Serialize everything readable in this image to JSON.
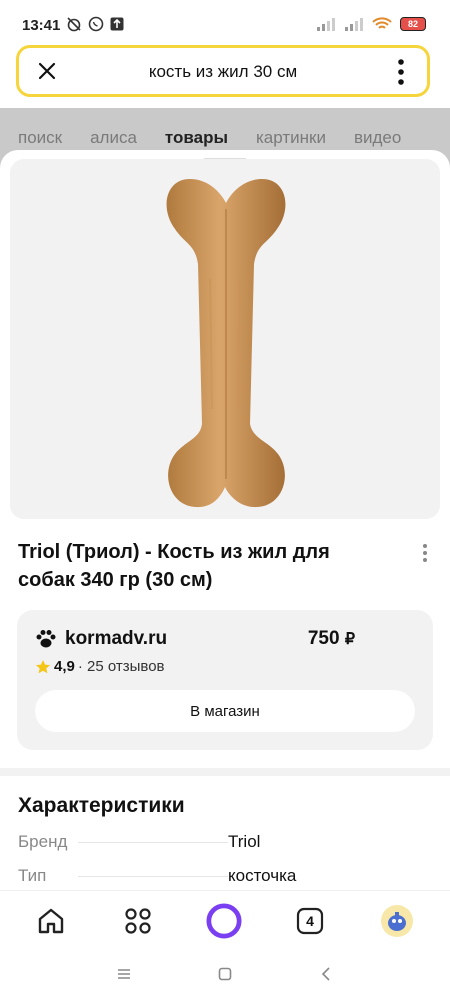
{
  "status": {
    "time": "13:41",
    "battery": "82"
  },
  "search": {
    "query": "кость из жил 30 см"
  },
  "tabs": [
    {
      "label": "поиск"
    },
    {
      "label": "алиса"
    },
    {
      "label": "товары"
    },
    {
      "label": "картинки"
    },
    {
      "label": "видео"
    }
  ],
  "product": {
    "title": "Triol (Триол) - Кость из жил для собак 340 гр (30 см)"
  },
  "shop": {
    "name": "kormadv.ru",
    "price": "750",
    "currency": "₽",
    "rating": "4,9",
    "reviews": "· 25 отзывов",
    "button": "В магазин"
  },
  "characteristics": {
    "title": "Характеристики",
    "rows": [
      {
        "key": "Бренд",
        "value": "Triol"
      },
      {
        "key": "Тип",
        "value": "косточка"
      }
    ]
  },
  "bottom_nav": {
    "tabs_count": "4"
  },
  "colors": {
    "accent": "#f5d53b",
    "alice": "#7b3ff2",
    "star": "#f5c518"
  }
}
